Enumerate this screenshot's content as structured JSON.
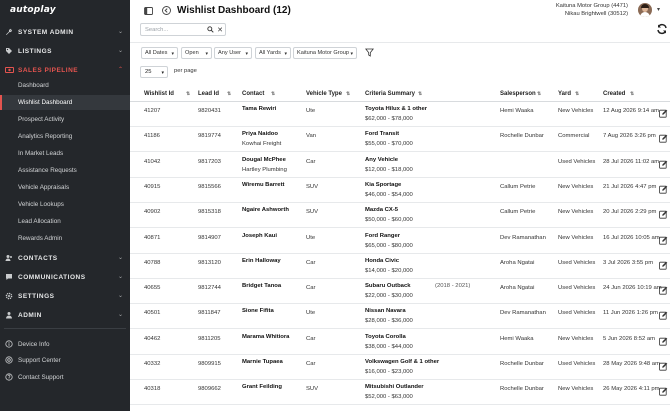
{
  "brand": "autoplay",
  "nav": {
    "system_admin": "SYSTEM ADMIN",
    "listings": "LISTINGS",
    "sales_pipeline": "SALES PIPELINE",
    "sales_items": [
      "Dashboard",
      "Wishlist Dashboard",
      "Prospect Activity",
      "Analytics Reporting",
      "In Market Leads",
      "Assistance Requests",
      "Vehicle Appraisals",
      "Vehicle Lookups",
      "Lead Allocation",
      "Rewards Admin"
    ],
    "contacts": "CONTACTS",
    "communications": "COMMUNICATIONS",
    "settings": "SETTINGS",
    "admin": "ADMIN",
    "bottom": [
      "Device Info",
      "Support Center",
      "Contact Support"
    ]
  },
  "header": {
    "title": "Wishlist Dashboard (12)",
    "org": "Kaituna Motor Group (4471)",
    "user": "Nikau Brightwell (30512)"
  },
  "filters": {
    "search_placeholder": "Search...",
    "dates": "All Dates",
    "status": "Open",
    "user": "Any User",
    "yards": "All Yards",
    "group": "Kaituna Motor Group",
    "per_page": "25",
    "per_page_label": "per page"
  },
  "table": {
    "headers": [
      "Wishlist Id",
      "Lead Id",
      "Contact",
      "Vehicle Type",
      "Criteria Summary",
      "Salesperson",
      "Yard",
      "Created"
    ],
    "rows": [
      {
        "wid": "41207",
        "lid": "9820431",
        "contact": "Tama Rewiri",
        "company": "",
        "type": "Ute",
        "criteria": "Toyota Hilux & 1 other",
        "extra": "",
        "price": "$62,000 - $78,000",
        "salesperson": "Hemi Waaka",
        "yard": "New Vehicles",
        "created": "12 Aug 2026 9:14 am"
      },
      {
        "wid": "41186",
        "lid": "9819774",
        "contact": "Priya Naidoo",
        "company": "Kowhai Freight",
        "type": "Van",
        "criteria": "Ford Transit",
        "extra": "",
        "price": "$55,000 - $70,000",
        "salesperson": "Rochelle Dunbar",
        "yard": "Commercial",
        "created": "7 Aug 2026 3:26 pm"
      },
      {
        "wid": "41042",
        "lid": "9817203",
        "contact": "Dougal McPhee",
        "company": "Hartley Plumbing",
        "type": "Car",
        "criteria": "Any Vehicle",
        "extra": "",
        "price": "$12,000 - $18,000",
        "salesperson": "",
        "yard": "Used Vehicles",
        "created": "28 Jul 2026 11:02 am"
      },
      {
        "wid": "40915",
        "lid": "9815566",
        "contact": "Wiremu Barrett",
        "company": "",
        "type": "SUV",
        "criteria": "Kia Sportage",
        "extra": "",
        "price": "$46,000 - $54,000",
        "salesperson": "Callum Petrie",
        "yard": "New Vehicles",
        "created": "21 Jul 2026 4:47 pm"
      },
      {
        "wid": "40902",
        "lid": "9815318",
        "contact": "Ngaire Ashworth",
        "company": "",
        "type": "SUV",
        "criteria": "Mazda CX-5",
        "extra": "",
        "price": "$50,000 - $60,000",
        "salesperson": "Callum Petrie",
        "yard": "New Vehicles",
        "created": "20 Jul 2026 2:29 pm"
      },
      {
        "wid": "40871",
        "lid": "9814907",
        "contact": "Joseph Kaui",
        "company": "",
        "type": "Ute",
        "criteria": "Ford Ranger",
        "extra": "",
        "price": "$65,000 - $80,000",
        "salesperson": "Dev Ramanathan",
        "yard": "New Vehicles",
        "created": "16 Jul 2026 10:05 am"
      },
      {
        "wid": "40788",
        "lid": "9813120",
        "contact": "Erin Halloway",
        "company": "",
        "type": "Car",
        "criteria": "Honda Civic",
        "extra": "",
        "price": "$14,000 - $20,000",
        "salesperson": "Aroha Ngatai",
        "yard": "Used Vehicles",
        "created": "3 Jul 2026 3:55 pm"
      },
      {
        "wid": "40655",
        "lid": "9812744",
        "contact": "Bridget Tanoa",
        "company": "",
        "type": "Car",
        "criteria": "Subaru Outback",
        "extra": "(2018 - 2021)",
        "price": "$22,000 - $30,000",
        "salesperson": "Aroha Ngatai",
        "yard": "Used Vehicles",
        "created": "24 Jun 2026 10:19 am"
      },
      {
        "wid": "40501",
        "lid": "9811847",
        "contact": "Sione Fifita",
        "company": "",
        "type": "Ute",
        "criteria": "Nissan Navara",
        "extra": "",
        "price": "$28,000 - $36,000",
        "salesperson": "Dev Ramanathan",
        "yard": "Used Vehicles",
        "created": "11 Jun 2026 1:26 pm"
      },
      {
        "wid": "40462",
        "lid": "9811205",
        "contact": "Marama Whitiora",
        "company": "",
        "type": "Car",
        "criteria": "Toyota Corolla",
        "extra": "",
        "price": "$38,000 - $44,000",
        "salesperson": "Hemi Waaka",
        "yard": "New Vehicles",
        "created": "5 Jun 2026 8:52 am"
      },
      {
        "wid": "40332",
        "lid": "9809915",
        "contact": "Marnie Tupaea",
        "company": "",
        "type": "Car",
        "criteria": "Volkswagen Golf & 1 other",
        "extra": "",
        "price": "$16,000 - $23,000",
        "salesperson": "Rochelle Dunbar",
        "yard": "Used Vehicles",
        "created": "28 May 2026 9:48 am"
      },
      {
        "wid": "40318",
        "lid": "9809662",
        "contact": "Grant Feilding",
        "company": "",
        "type": "SUV",
        "criteria": "Mitsubishi Outlander",
        "extra": "",
        "price": "$52,000 - $63,000",
        "salesperson": "Rochelle Dunbar",
        "yard": "New Vehicles",
        "created": "26 May 2026 4:11 pm"
      }
    ]
  }
}
